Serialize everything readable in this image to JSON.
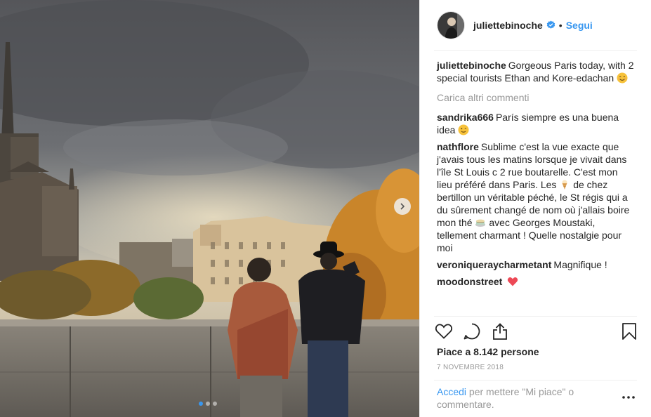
{
  "header": {
    "username": "juliettebinoche",
    "separator": "•",
    "follow_label": "Segui"
  },
  "caption": {
    "username": "juliettebinoche",
    "text": "Gorgeous Paris today, with 2 special tourists Ethan and Kore-edachan"
  },
  "load_more_label": "Carica altri commenti",
  "comments": [
    {
      "username": "sandrika666",
      "text": "París siempre es una buena idea"
    },
    {
      "username": "nathflore",
      "text_a": "Sublime c'est la vue exacte que j'avais tous les matins lorsque je vivait dans l'île St Louis c 2 rue boutarelle. C'est mon lieu préféré dans Paris. Les",
      "text_b": "de chez bertillon un véritable péché, le St régis qui a du sûrement changé de nom où j'allais boire mon thé",
      "text_c": "avec Georges Moustaki, tellement charmant ! Quelle nostalgie pour moi"
    },
    {
      "username": "veroniqueraycharmetant",
      "text": "Magnifique !"
    },
    {
      "username": "moodonstreet",
      "text": ""
    }
  ],
  "likes": "Piace a 8.142 persone",
  "date": "7 NOVEMBRE 2018",
  "login": {
    "link_label": "Accedi",
    "rest": "per mettere \"Mi piace\" o commentare."
  },
  "icons": {
    "verified": "verified-badge-icon",
    "like": "heart-outline-icon",
    "comment": "speech-bubble-icon",
    "share": "share-icon",
    "save": "bookmark-icon",
    "more": "ellipsis-icon",
    "next": "chevron-right-icon"
  },
  "colors": {
    "link_blue": "#3897f0",
    "heart_red": "#ed4956",
    "muted": "#999999",
    "text": "#262626"
  },
  "carousel": {
    "count": 3,
    "active": 1
  }
}
